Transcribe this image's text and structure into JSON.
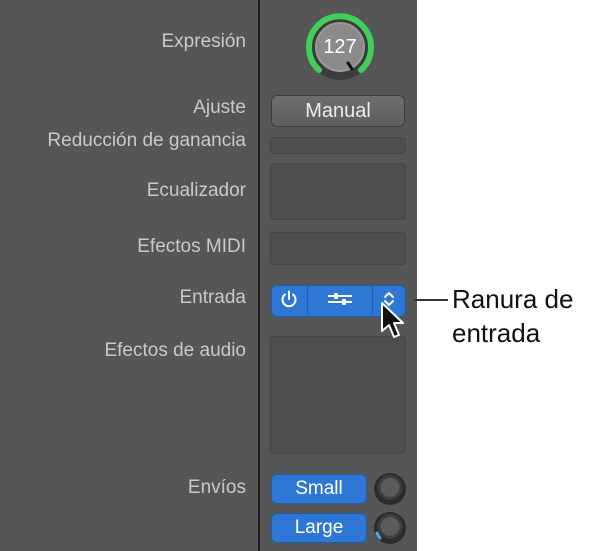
{
  "labels": {
    "expression": "Expresión",
    "setting": "Ajuste",
    "gain_reduction": "Reducción de ganancia",
    "eq": "Ecualizador",
    "midi_fx": "Efectos MIDI",
    "input": "Entrada",
    "audio_fx": "Efectos de audio",
    "sends": "Envíos"
  },
  "expression_knob": {
    "value": "127"
  },
  "setting_button": {
    "label": "Manual"
  },
  "input_slot": {
    "power_icon": "power-icon",
    "settings_icon": "sliders-icon",
    "menu_icon": "up-down-chevron-icon"
  },
  "sends": [
    {
      "label": "Small"
    },
    {
      "label": "Large"
    }
  ],
  "callout": {
    "line1": "Ranura de",
    "line2": "entrada"
  },
  "colors": {
    "panel": "#565656",
    "accent_blue": "#2f77d4",
    "knob_ring_green": "#3fcf5a"
  }
}
